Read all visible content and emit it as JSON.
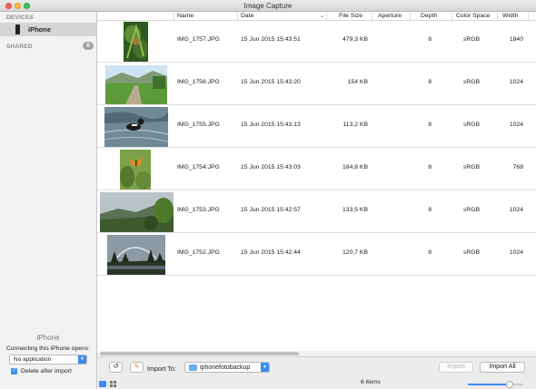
{
  "window": {
    "title": "Image Capture"
  },
  "sidebar": {
    "devices_header": "DEVICES",
    "device": "iPhone",
    "shared_header": "SHARED",
    "shared_count": "0",
    "bottom": {
      "device_name": "iPhone",
      "connecting_label": "Connecting this iPhone opens:",
      "app_select": "No application",
      "delete_after_import": "Delete after import",
      "delete_checked": true
    }
  },
  "table": {
    "columns": [
      "Name",
      "Date",
      "File Size",
      "Aperture",
      "Depth",
      "Color Space",
      "Width"
    ],
    "sorted_by": "Date",
    "rows": [
      {
        "name": "IMG_1757.JPG",
        "date": "15 Jun 2015 15:43:51",
        "size": "479,3 KB",
        "aperture": "",
        "depth": "8",
        "color_space": "sRGB",
        "width": "1840"
      },
      {
        "name": "IMG_1756.JPG",
        "date": "15 Jun 2015 15:43:20",
        "size": "154 KB",
        "aperture": "",
        "depth": "8",
        "color_space": "sRGB",
        "width": "1024"
      },
      {
        "name": "IMG_1755.JPG",
        "date": "15 Jun 2015 15:43:13",
        "size": "113,2 KB",
        "aperture": "",
        "depth": "8",
        "color_space": "sRGB",
        "width": "1024"
      },
      {
        "name": "IMG_1754.JPG",
        "date": "15 Jun 2015 15:43:03",
        "size": "184,8 KB",
        "aperture": "",
        "depth": "8",
        "color_space": "sRGB",
        "width": "768"
      },
      {
        "name": "IMG_1753.JPG",
        "date": "15 Jun 2015 15:42:57",
        "size": "133,5 KB",
        "aperture": "",
        "depth": "8",
        "color_space": "sRGB",
        "width": "1024"
      },
      {
        "name": "IMG_1752.JPG",
        "date": "15 Jun 2015 15:42:44",
        "size": "120,7 KB",
        "aperture": "",
        "depth": "8",
        "color_space": "sRGB",
        "width": "1024"
      }
    ]
  },
  "toolbar": {
    "import_to_label": "Import To:",
    "destination": "iphonefotobackup",
    "import_button": "Import",
    "import_all_button": "Import All"
  },
  "status": {
    "items_count": "6 items",
    "zoom_level": 0.8
  },
  "colors": {
    "accent": "#3b8cf2"
  },
  "icons": [
    "rotate-left-icon",
    "annotate-icon",
    "folder-icon",
    "phone-icon",
    "eject-icon",
    "list-view-icon",
    "grid-view-icon"
  ]
}
